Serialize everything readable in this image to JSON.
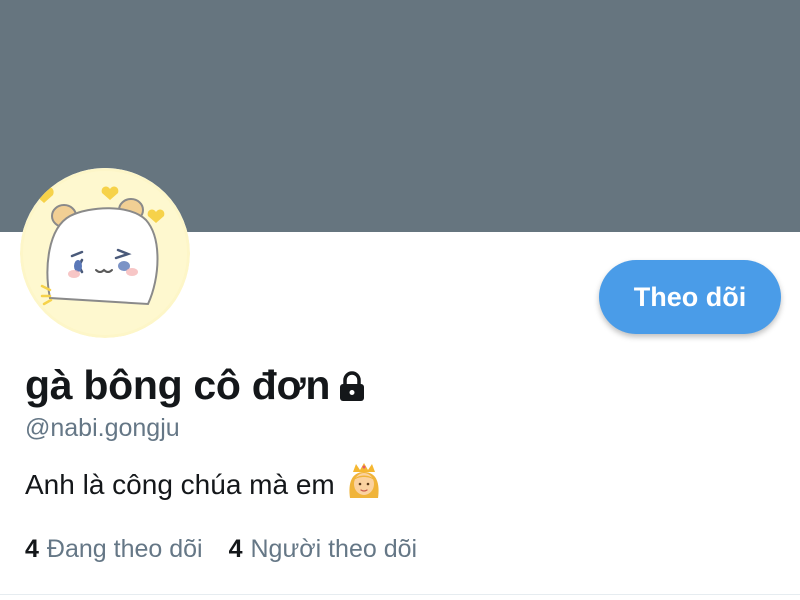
{
  "profile": {
    "display_name": "gà bông cô đơn",
    "handle": "@nabi.gongju",
    "bio": "Anh là công chúa mà em",
    "bio_emoji": "princess-emoji",
    "is_protected": true,
    "lock_icon": "lock-icon",
    "avatar_icon": "cartoon-hamster-avatar"
  },
  "actions": {
    "follow_label": "Theo dõi"
  },
  "stats": {
    "following_count": "4",
    "following_label": "Đang theo dõi",
    "followers_count": "4",
    "followers_label": "Người theo dõi"
  },
  "colors": {
    "banner": "#66757f",
    "accent": "#4a9ce8",
    "text_primary": "#14171a",
    "text_secondary": "#657786",
    "avatar_bg": "#fdf6c8"
  }
}
